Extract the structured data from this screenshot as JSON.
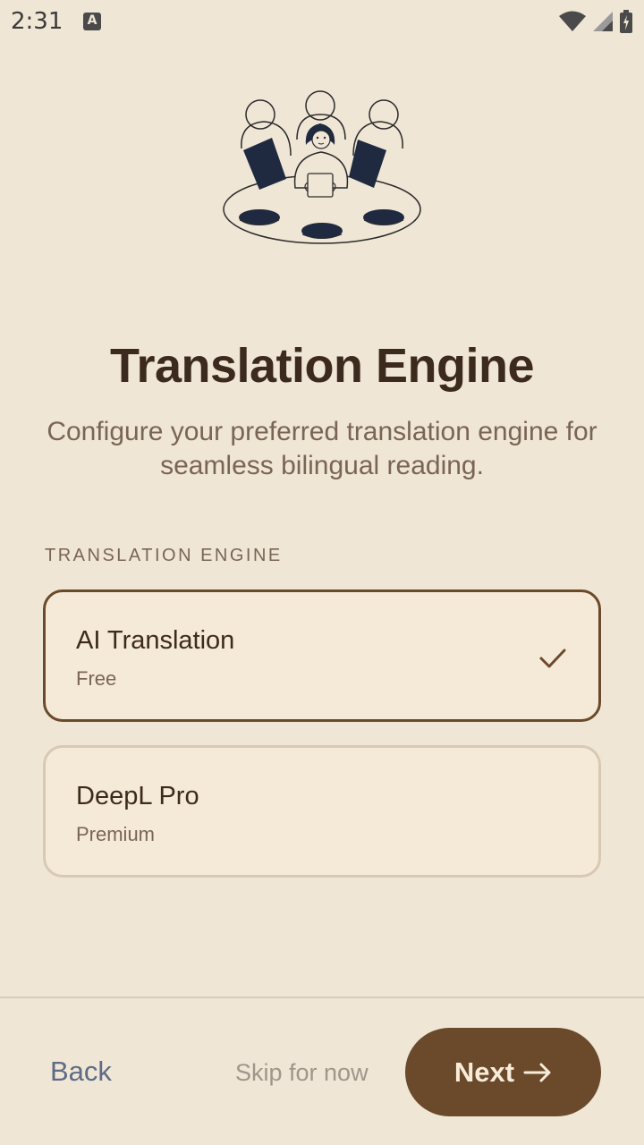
{
  "status_bar": {
    "time": "2:31",
    "notification_icon": "A",
    "icons": [
      "wifi-icon",
      "signal-icon",
      "battery-icon"
    ]
  },
  "illustration": {
    "description_icon": "team-meeting-illustration"
  },
  "header": {
    "title": "Translation Engine",
    "subtitle": "Configure your preferred translation engine for seamless bilingual reading."
  },
  "section": {
    "label": "TRANSLATION ENGINE"
  },
  "options": [
    {
      "title": "AI Translation",
      "subtitle": "Free",
      "selected": true
    },
    {
      "title": "DeepL Pro",
      "subtitle": "Premium",
      "selected": false
    }
  ],
  "footer": {
    "back_label": "Back",
    "skip_label": "Skip for now",
    "next_label": "Next"
  },
  "colors": {
    "background": "#f0e6d6",
    "accent": "#6b4a2b",
    "card": "#f5ead8",
    "back_text": "#5d6b85"
  }
}
